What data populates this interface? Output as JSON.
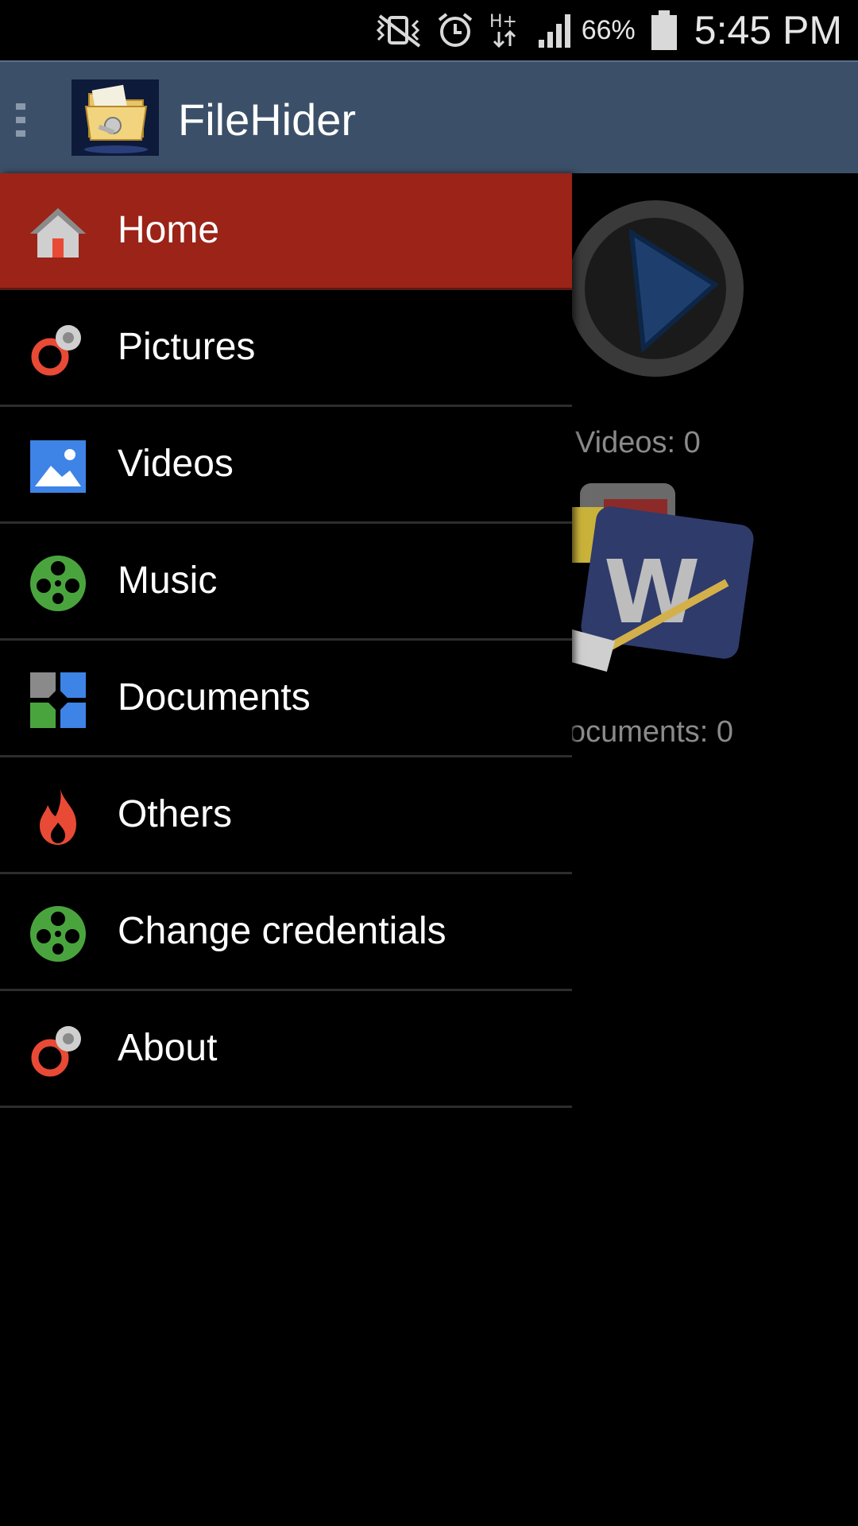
{
  "status_bar": {
    "battery_percent": "66%",
    "time": "5:45 PM",
    "network_type": "H+",
    "icons": [
      "vibrate-off-icon",
      "alarm-icon",
      "network-hplus-icon",
      "signal-icon",
      "battery-icon"
    ]
  },
  "action_bar": {
    "title": "FileHider",
    "logo_icon": "folder-lock-logo-icon"
  },
  "drawer": {
    "items": [
      {
        "label": "Home",
        "icon": "home-icon",
        "active": true
      },
      {
        "label": "Pictures",
        "icon": "rings-icon"
      },
      {
        "label": "Videos",
        "icon": "picture-icon"
      },
      {
        "label": "Music",
        "icon": "film-reel-icon"
      },
      {
        "label": "Documents",
        "icon": "puzzle-icon"
      },
      {
        "label": "Others",
        "icon": "flame-icon"
      },
      {
        "label": "Change credentials",
        "icon": "film-reel-icon"
      },
      {
        "label": "About",
        "icon": "rings-icon"
      }
    ]
  },
  "background": {
    "tiles": [
      {
        "label": "Videos: 0",
        "icon": "play-button-icon"
      },
      {
        "label": "ocuments: 0",
        "icon": "word-document-icon"
      }
    ]
  },
  "colors": {
    "action_bar": "#3b5068",
    "active_item": "#9b2318",
    "divider": "#2d2d2d"
  }
}
